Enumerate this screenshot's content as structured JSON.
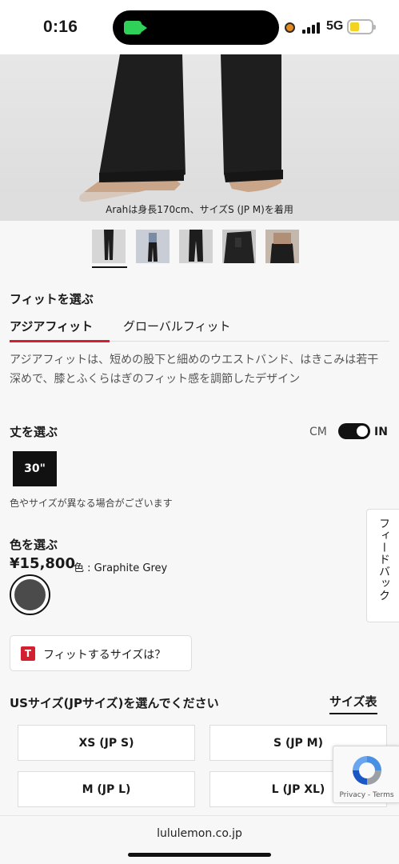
{
  "status_bar": {
    "time": "0:16",
    "network": "5G"
  },
  "product_image": {
    "caption": "Arahは身長170cm、サイズS (JP M)を着用",
    "thumbnail_count": 5
  },
  "fit": {
    "title": "フィットを選ぶ",
    "tabs": [
      {
        "label": "アジアフィット",
        "active": true
      },
      {
        "label": "グローバルフィット",
        "active": false
      }
    ],
    "description": "アジアフィットは、短めの股下と細めのウエストバンド、はきこみは若干深めで、膝とふくらはぎのフィット感を調節したデザイン"
  },
  "length": {
    "title": "丈を選ぶ",
    "unit_cm": "CM",
    "unit_in": "IN",
    "unit_selected": "IN",
    "selected_value": "30\"",
    "note": "色やサイズが異なる場合がございます"
  },
  "color": {
    "title": "色を選ぶ",
    "price": "¥15,800",
    "color_prefix": "色 : ",
    "color_name": "Graphite Grey",
    "swatch_hex": "#4b4b4b"
  },
  "feedback": {
    "label": "フィードバック"
  },
  "fit_finder": {
    "icon_letter": "T",
    "label": "フィットするサイズは？"
  },
  "sizes": {
    "title": "USサイズ(JPサイズ)を選んでください",
    "size_chart_label": "サイズ表",
    "options": [
      "XS (JP S)",
      "S (JP M)",
      "M (JP L)",
      "L (JP XL)"
    ]
  },
  "recaptcha": {
    "label": "Privacy - Terms"
  },
  "browser": {
    "url": "lululemon.co.jp"
  },
  "colors": {
    "accent_red": "#d31f2f",
    "black": "#111111",
    "background": "#f7f7f7"
  }
}
